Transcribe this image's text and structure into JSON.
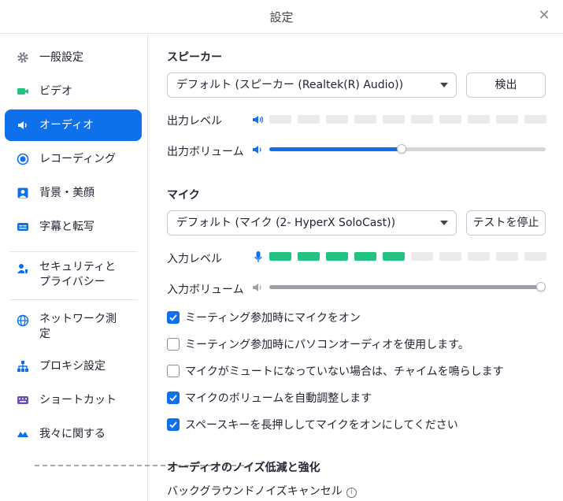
{
  "window": {
    "title": "設定"
  },
  "sidebar": {
    "items": [
      {
        "label": "一般設定",
        "icon": "gear-icon",
        "color": "#7b7b86"
      },
      {
        "label": "ビデオ",
        "icon": "video-camera-icon",
        "color": "#23c483"
      },
      {
        "label": "オーディオ",
        "icon": "speaker-icon",
        "color": "#ffffff",
        "active": true
      },
      {
        "label": "レコーディング",
        "icon": "record-icon",
        "color": "#0e71eb"
      },
      {
        "label": "背景・美顔",
        "icon": "person-background-icon",
        "color": "#0e71eb"
      },
      {
        "label": "字幕と転写",
        "icon": "captions-icon",
        "color": "#0e71eb"
      },
      {
        "label": "セキュリティと\nプライバシー",
        "icon": "user-shield-icon",
        "color": "#0e71eb"
      },
      {
        "label": "ネットワーク測\n定",
        "icon": "globe-icon",
        "color": "#0e71eb"
      },
      {
        "label": "プロキシ設定",
        "icon": "network-icon",
        "color": "#0e71eb"
      },
      {
        "label": "ショートカット",
        "icon": "keyboard-icon",
        "color": "#6b4fbb"
      },
      {
        "label": "我々に関する",
        "icon": "zoom-logo-icon",
        "color": "#0e71eb"
      }
    ]
  },
  "speaker": {
    "section_title": "スピーカー",
    "device": "デフォルト (スピーカー (Realtek(R) Audio))",
    "test_button": "検出",
    "output_level_label": "出力レベル",
    "output_level_segments_on": 0,
    "output_level_segments_total": 10,
    "output_volume_label": "出力ボリューム",
    "output_volume": 0.48
  },
  "mic": {
    "section_title": "マイク",
    "device": "デフォルト (マイク (2- HyperX SoloCast))",
    "test_button": "テストを停止",
    "input_level_label": "入力レベル",
    "input_level_segments_on": 5,
    "input_level_segments_total": 10,
    "input_volume_label": "入力ボリューム",
    "input_volume": 1.0
  },
  "options": [
    {
      "label": "ミーティング参加時にマイクをオン",
      "checked": true
    },
    {
      "label": "ミーティング参加時にパソコンオーディオを使用します。",
      "checked": false
    },
    {
      "label": "マイクがミュートになっていない場合は、チャイムを鳴らします",
      "checked": false
    },
    {
      "label": "マイクのボリュームを自動調整します",
      "checked": true
    },
    {
      "label": "スペースキーを長押ししてマイクをオンにしてください",
      "checked": true
    }
  ],
  "noise": {
    "section_title": "オーディオのノイズ低減と強化",
    "background_noise_label": "バックグラウンドノイズキャンセル"
  },
  "colors": {
    "accent": "#0e71eb",
    "level_on": "#23c483",
    "muted_slider": "#a0a0a8"
  }
}
